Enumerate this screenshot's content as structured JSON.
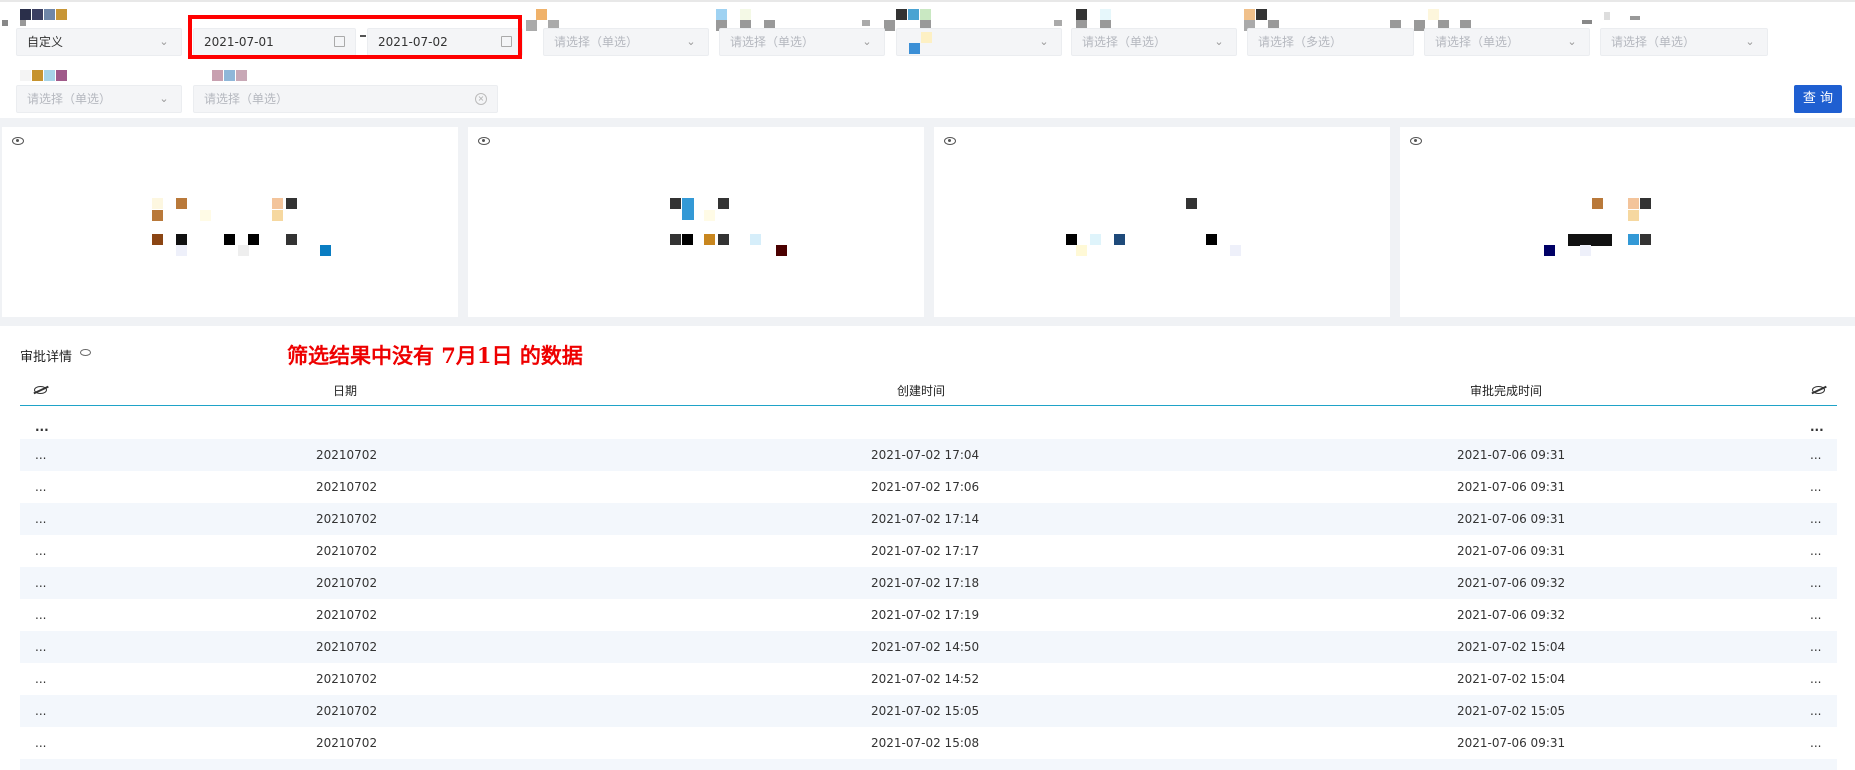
{
  "filters": {
    "range_type": "自定义",
    "start_date": "2021-07-01",
    "end_date": "2021-07-02",
    "single_placeholder": "请选择（单选）",
    "multi_placeholder": "请选择（多选）",
    "query_label": "查 询"
  },
  "details": {
    "title": "审批详情",
    "annotation": "筛选结果中没有 7月1日 的数据",
    "columns": [
      "日期",
      "创建时间",
      "审批完成时间"
    ],
    "ellipsis": "...",
    "rows": [
      {
        "date": "20210702",
        "created": "2021-07-02 17:04",
        "completed": "2021-07-06 09:31"
      },
      {
        "date": "20210702",
        "created": "2021-07-02 17:06",
        "completed": "2021-07-06 09:31"
      },
      {
        "date": "20210702",
        "created": "2021-07-02 17:14",
        "completed": "2021-07-06 09:31"
      },
      {
        "date": "20210702",
        "created": "2021-07-02 17:17",
        "completed": "2021-07-06 09:31"
      },
      {
        "date": "20210702",
        "created": "2021-07-02 17:18",
        "completed": "2021-07-06 09:32"
      },
      {
        "date": "20210702",
        "created": "2021-07-02 17:19",
        "completed": "2021-07-06 09:32"
      },
      {
        "date": "20210702",
        "created": "2021-07-02 14:50",
        "completed": "2021-07-02 15:04"
      },
      {
        "date": "20210702",
        "created": "2021-07-02 14:52",
        "completed": "2021-07-02 15:04"
      },
      {
        "date": "20210702",
        "created": "2021-07-02 15:05",
        "completed": "2021-07-02 15:05"
      },
      {
        "date": "20210702",
        "created": "2021-07-02 15:08",
        "completed": "2021-07-06 09:31"
      }
    ]
  },
  "colors": {
    "accent": "#1f5fd1",
    "highlight": "#ff0000",
    "header_line": "#1fa3c8",
    "alt_row": "#f3f7fc"
  }
}
